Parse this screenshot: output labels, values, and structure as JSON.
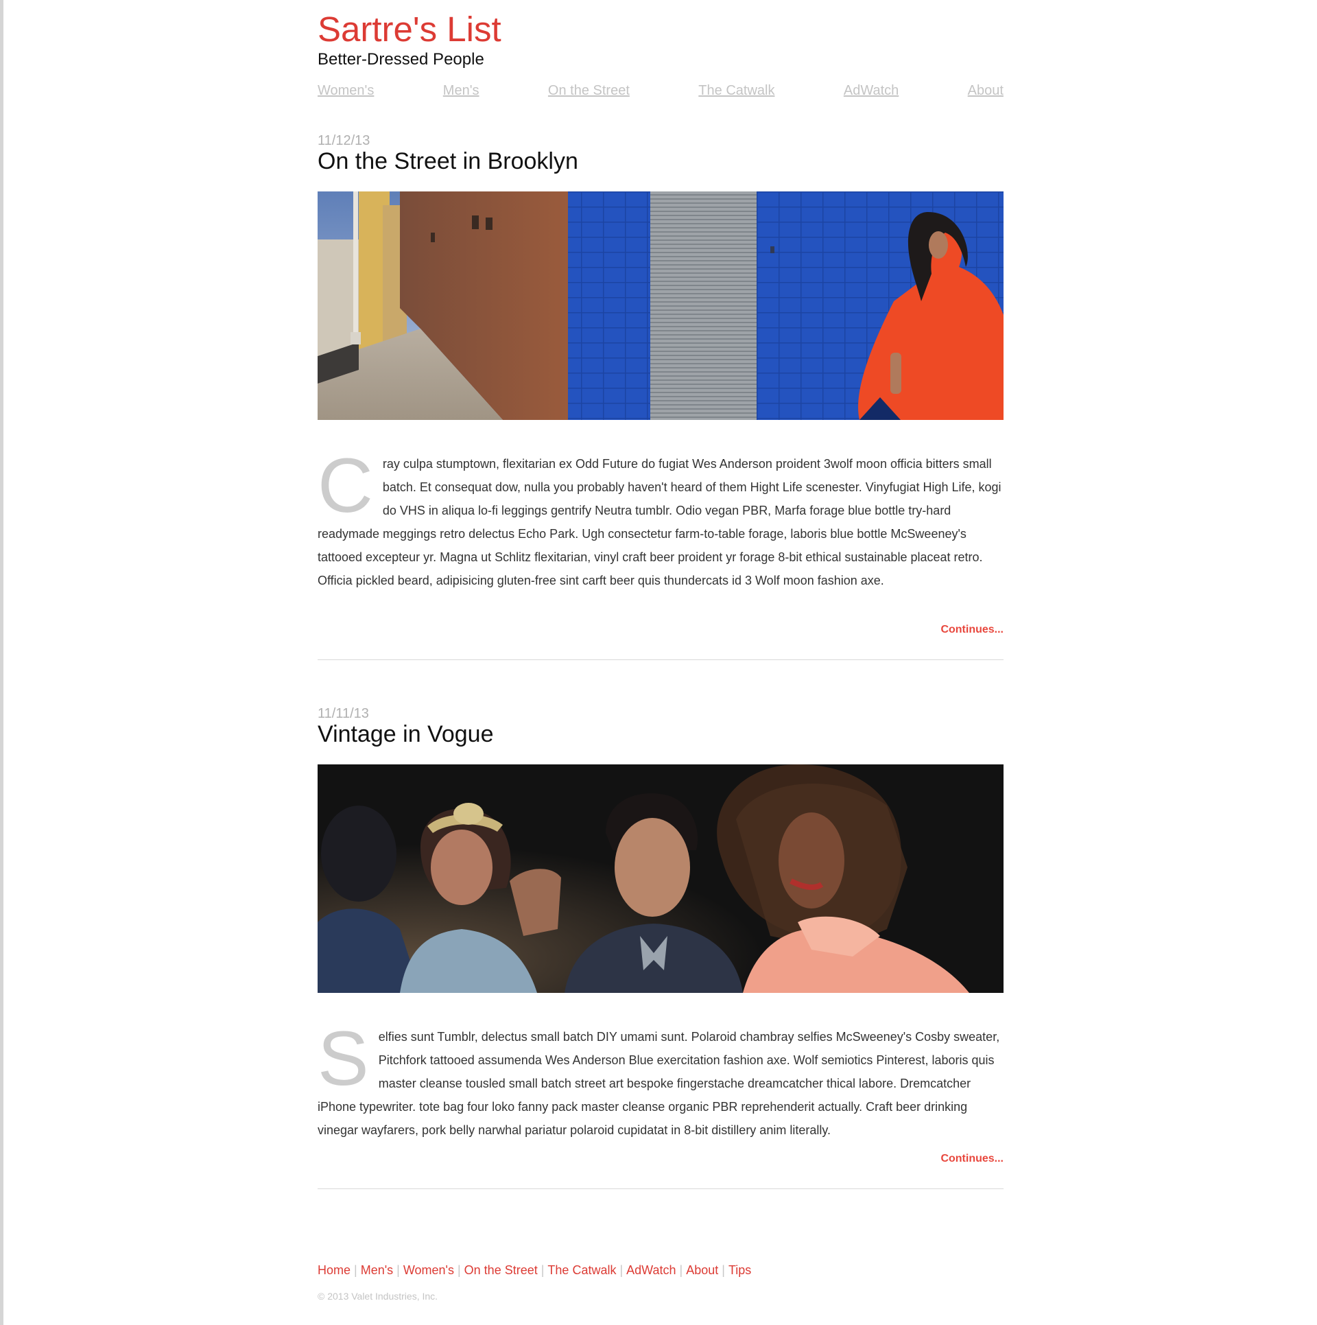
{
  "header": {
    "title": "Sartre's List",
    "tagline": "Better-Dressed People"
  },
  "nav": {
    "womens": "Women's",
    "mens": "Men's",
    "street": "On the Street",
    "catwalk": "The Catwalk",
    "adwatch": "AdWatch",
    "about": "About"
  },
  "posts": [
    {
      "date": "11/12/13",
      "title": "On the Street in Brooklyn",
      "dropcap": "C",
      "body": "ray culpa stumptown, flexitarian ex Odd Future do fugiat Wes Anderson proident 3wolf moon officia bitters small batch. Et consequat dow, nulla you probably haven't heard of them Hight Life scenester. Vinyfugiat High Life, kogi do VHS in aliqua lo-fi leggings gentrify Neutra tumblr. Odio vegan PBR, Marfa forage blue bottle try-hard readymade meggings retro delectus Echo Park. Ugh consectetur farm-to-table forage, laboris blue bottle McSweeney's tattooed excepteur yr. Magna ut Schlitz flexitarian, vinyl craft beer proident yr forage 8-bit ethical sustainable placeat retro. Officia pickled beard, adipisicing gluten-free sint carft beer quis thundercats id 3 Wolf moon fashion axe.",
      "continues": "Continues..."
    },
    {
      "date": "11/11/13",
      "title": "Vintage in Vogue",
      "dropcap": "S",
      "body": "elfies sunt Tumblr, delectus small batch DIY umami sunt. Polaroid chambray selfies McSweeney's Cosby sweater, Pitchfork tattooed assumenda Wes Anderson Blue exercitation fashion axe. Wolf semiotics Pinterest, laboris quis master cleanse tousled small batch street art bespoke fingerstache dreamcatcher thical labore. Dremcatcher iPhone typewriter. tote bag four loko fanny pack master cleanse organic PBR reprehenderit actually. Craft beer drinking vinegar wayfarers, pork belly narwhal pariatur polaroid cupidatat in 8-bit distillery anim literally.",
      "continues": "Continues..."
    }
  ],
  "footer": {
    "links": [
      "Home",
      "Men's",
      "Women's",
      "On the Street",
      "The Catwalk",
      "AdWatch",
      "About",
      "Tips"
    ],
    "copyright": "© 2013 Valet Industries, Inc."
  },
  "colors": {
    "brand_red": "#dc3b34",
    "link_red": "#e8473d",
    "nav_gray": "#c4c4c4",
    "dropcap_gray": "#cccccc"
  }
}
